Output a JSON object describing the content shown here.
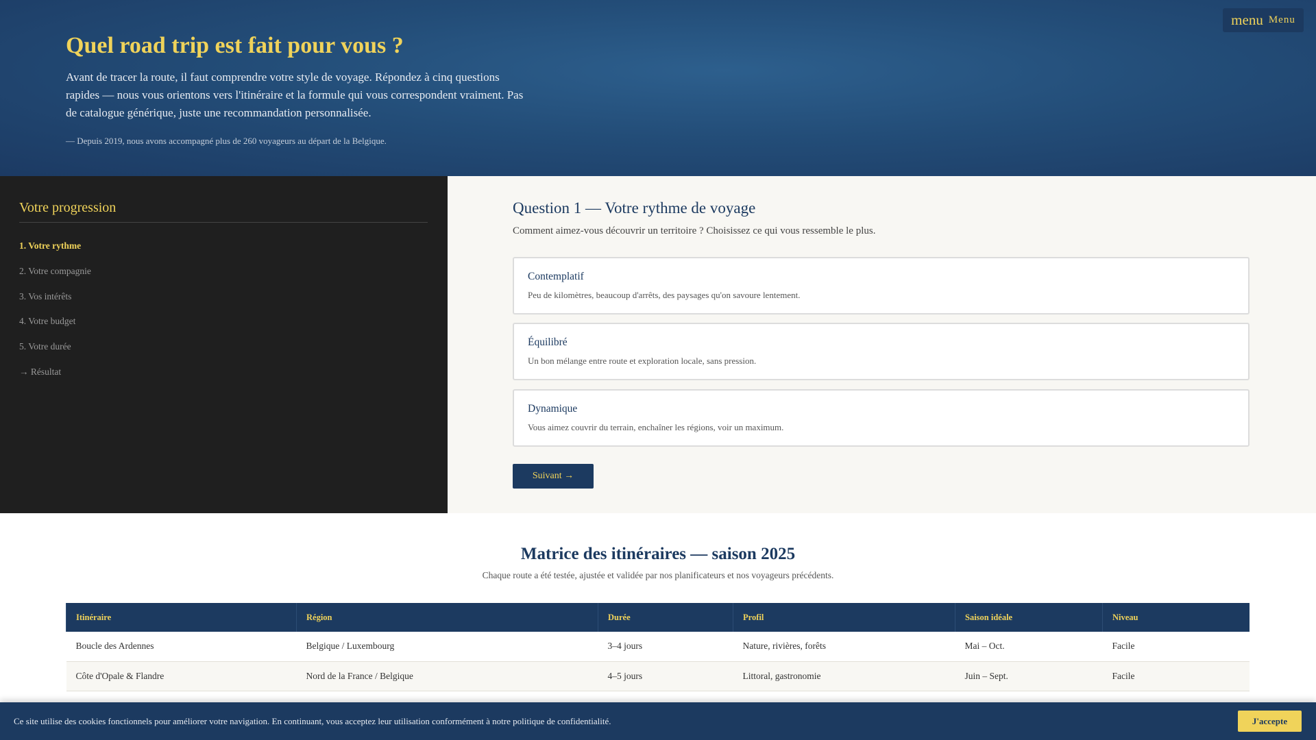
{
  "hero": {
    "title": "Quel road trip est fait pour vous ?",
    "lead": "Avant de tracer la route, il faut comprendre votre style de voyage. Répondez à cinq questions rapides — nous vous orientons vers l'itinéraire et la formule qui vous correspondent vraiment. Pas de catalogue générique, juste une recommandation personnalisée.",
    "note": "— Depuis 2019, nous avons accompagné plus de 260 voyageurs au départ de la Belgique."
  },
  "menu": {
    "icon": "menu",
    "label": "Menu"
  },
  "sidebar": {
    "title": "Votre progression",
    "items": [
      {
        "label": "1. Votre rythme"
      },
      {
        "label": "2. Votre compagnie"
      },
      {
        "label": "3. Vos intérêts"
      },
      {
        "label": "4. Votre budget"
      },
      {
        "label": "5. Votre durée"
      },
      {
        "label": "→ Résultat"
      }
    ]
  },
  "question": {
    "title": "Question 1 — Votre rythme de voyage",
    "prompt": "Comment aimez-vous découvrir un territoire ? Choisissez ce qui vous ressemble le plus.",
    "options": [
      {
        "title": "Contemplatif",
        "desc": "Peu de kilomètres, beaucoup d'arrêts, des paysages qu'on savoure lentement."
      },
      {
        "title": "Équilibré",
        "desc": "Un bon mélange entre route et exploration locale, sans pression."
      },
      {
        "title": "Dynamique",
        "desc": "Vous aimez couvrir du terrain, enchaîner les régions, voir un maximum."
      }
    ],
    "next": "Suivant →"
  },
  "matrix": {
    "title": "Matrice des itinéraires — saison 2025",
    "subtitle": "Chaque route a été testée, ajustée et validée par nos planificateurs et nos voyageurs précédents.",
    "headers": [
      "Itinéraire",
      "Région",
      "Durée",
      "Profil",
      "Saison idéale",
      "Niveau"
    ],
    "rows": [
      [
        "Boucle des Ardennes",
        "Belgique / Luxembourg",
        "3–4 jours",
        "Nature, rivières, forêts",
        "Mai – Oct.",
        "Facile"
      ],
      [
        "Côte d'Opale & Flandre",
        "Nord de la France / Belgique",
        "4–5 jours",
        "Littoral, gastronomie",
        "Juin – Sept.",
        "Facile"
      ]
    ]
  },
  "cookie": {
    "text": "Ce site utilise des cookies fonctionnels pour améliorer votre navigation. En continuant, vous acceptez leur utilisation conformément à notre politique de confidentialité.",
    "accept": "J'accepte"
  }
}
